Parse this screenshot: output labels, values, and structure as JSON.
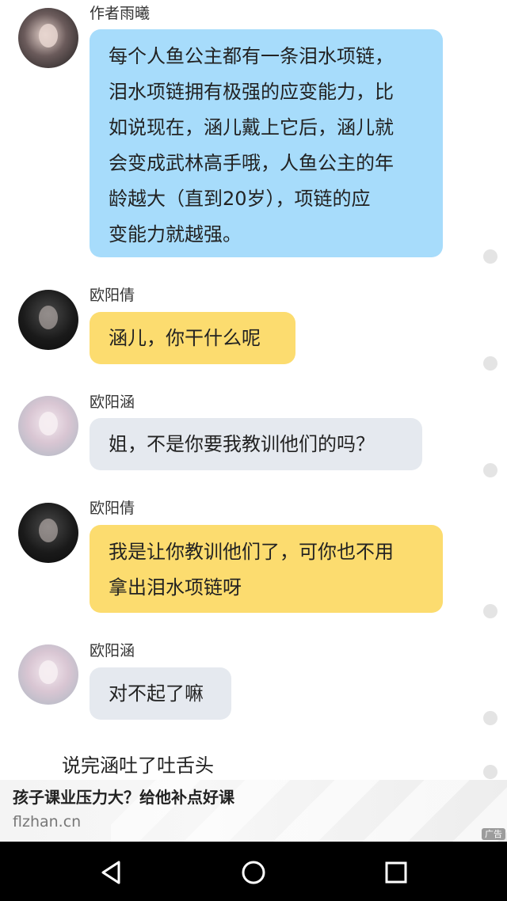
{
  "messages": [
    {
      "sender": "作者雨曦",
      "bubble_color": "#a7dcfb",
      "lines": [
        "每个人鱼公主都有一条泪水项链，",
        "泪水项链拥有极强的应变能力，比",
        "如说现在，涵儿戴上它后，涵儿就",
        "会变成武林高手哦，人鱼公主的年",
        "龄越大（直到20岁），项链的应",
        "变能力就越强。"
      ]
    },
    {
      "sender": "欧阳倩",
      "bubble_color": "#fcdc6f",
      "lines": [
        "涵儿，你干什么呢"
      ]
    },
    {
      "sender": "欧阳涵",
      "bubble_color": "#e5e9ef",
      "lines": [
        "姐，不是你要我教训他们的吗？"
      ]
    },
    {
      "sender": "欧阳倩",
      "bubble_color": "#fcdc6f",
      "lines": [
        "我是让你教训他们了，可你也不用",
        "拿出泪水项链呀"
      ]
    },
    {
      "sender": "欧阳涵",
      "bubble_color": "#e5e9ef",
      "lines": [
        "对不起了嘛"
      ]
    }
  ],
  "narration": "说完涵吐了吐舌头",
  "ad": {
    "title": "孩子课业压力大？给他补点好课",
    "url": "flzhan.cn",
    "badge": "广告"
  },
  "navbar": {
    "back_icon": "back-triangle-icon",
    "home_icon": "home-circle-icon",
    "recent_icon": "recent-apps-square-icon"
  }
}
